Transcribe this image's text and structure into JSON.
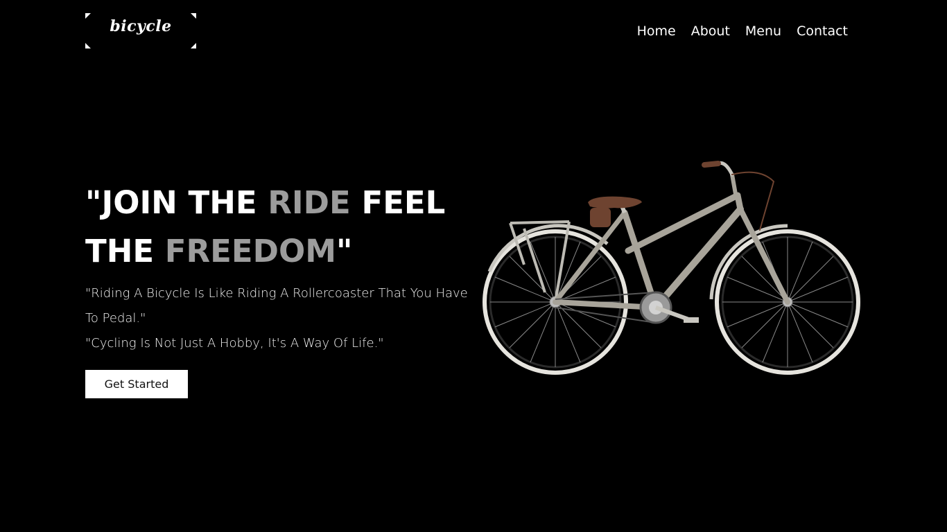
{
  "logo": {
    "text": "bicycle"
  },
  "nav": {
    "items": [
      "Home",
      "About",
      "Menu",
      "Contact"
    ]
  },
  "hero": {
    "title_parts": [
      {
        "text": "\"JOIN THE ",
        "muted": false
      },
      {
        "text": "RIDE",
        "muted": true
      },
      {
        "text": " FEEL THE ",
        "muted": false
      },
      {
        "text": "FREEDOM",
        "muted": true
      },
      {
        "text": "\"",
        "muted": false
      }
    ],
    "quote_1": "\"Riding A Bicycle Is Like Riding A Rollercoaster That You Have To Pedal.\"",
    "quote_2": "\"Cycling Is Not Just A Hobby, It's A Way Of Life.\"",
    "cta_label": "Get Started"
  },
  "colors": {
    "background": "#000000",
    "text": "#ffffff",
    "muted_text": "#9c9c9c",
    "bike_frame": "#a8a49a",
    "saddle": "#6e4330"
  },
  "image": {
    "subject": "city bicycle with rear rack and brown saddle"
  }
}
